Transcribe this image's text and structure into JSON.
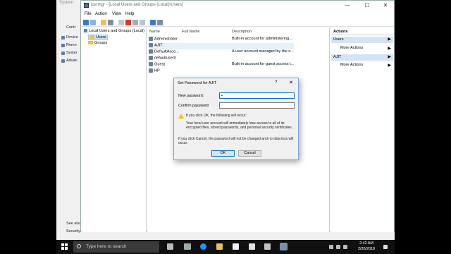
{
  "background_window": {
    "title": "System",
    "sidebar_items": [
      "Contr",
      "Device",
      "Remo",
      "Syster",
      "Advan"
    ],
    "see_also": "See also",
    "security": "Security"
  },
  "window": {
    "title": "lusrmgr - [Local Users and Groups (Local)\\Users]",
    "minimize": "—",
    "maximize": "☐",
    "close": "✕"
  },
  "menu": [
    "File",
    "Action",
    "View",
    "Help"
  ],
  "tree": {
    "root": "Local Users and Groups (Local)",
    "items": [
      "Users",
      "Groups"
    ]
  },
  "list": {
    "columns": [
      "Name",
      "Full Name",
      "Description"
    ],
    "rows": [
      {
        "name": "Administrator",
        "full_name": "",
        "description": "Built-in account for administering..."
      },
      {
        "name": "AJIT",
        "full_name": "",
        "description": ""
      },
      {
        "name": "DefaultAcco...",
        "full_name": "",
        "description": "A user account managed by the s..."
      },
      {
        "name": "defaultuser0",
        "full_name": "",
        "description": ""
      },
      {
        "name": "Guest",
        "full_name": "",
        "description": "Built-in account for guest access t..."
      },
      {
        "name": "HP",
        "full_name": "",
        "description": ""
      }
    ]
  },
  "actions": {
    "header": "Actions",
    "groups": [
      {
        "title": "Users",
        "item": "More Actions"
      },
      {
        "title": "AJIT",
        "item": "More Actions"
      }
    ],
    "arrow": "▶"
  },
  "dialog": {
    "title": "Set Password for AJIT",
    "help": "?",
    "close": "✕",
    "new_password_label": "New password:",
    "new_password_value": "•",
    "confirm_password_label": "Confirm password:",
    "confirm_password_value": "",
    "warning_heading": "If you click OK, the following will occur:",
    "warning_line1": "Your local user account will immediately lose access to all of its",
    "warning_line2": "encrypted files, stored passwords, and personal security certificates.",
    "cancel_note_line1": "If you click Cancel, the password will not be changed and no data loss will",
    "cancel_note_line2": "occur.",
    "ok_label": "OK",
    "cancel_label": "Cancel"
  },
  "taskbar": {
    "search_placeholder": "Type here to search",
    "time": "2:42 AM",
    "date": "2/20/2018"
  },
  "colors": {
    "accent": "#0078d7",
    "selection": "#cce4f7",
    "taskbar": "#101010"
  }
}
